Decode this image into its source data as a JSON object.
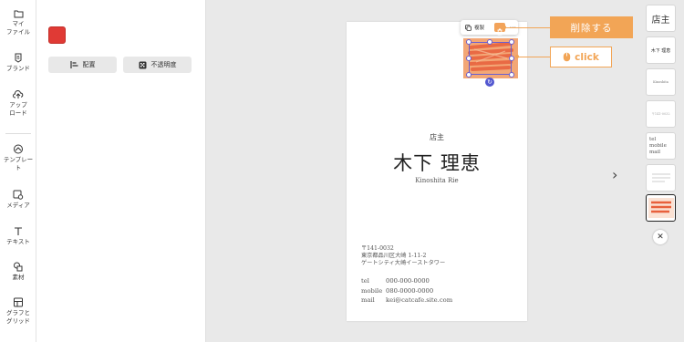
{
  "sidebar": {
    "items": [
      {
        "icon": "folder-icon",
        "label": "マイ\nファイル"
      },
      {
        "icon": "brand-icon",
        "label": "ブランド"
      },
      {
        "icon": "upload-icon",
        "label": "アップ\nロード"
      },
      {
        "icon": "template-icon",
        "label": "テンプレー\nト"
      },
      {
        "icon": "media-icon",
        "label": "メディア"
      },
      {
        "icon": "text-icon",
        "label": "テキスト"
      },
      {
        "icon": "elements-icon",
        "label": "素材"
      },
      {
        "icon": "chart-icon",
        "label": "グラフと\nグリッド"
      }
    ]
  },
  "panel": {
    "selected_color": "#e03a35",
    "align_label": "配置",
    "opacity_label": "不透明度"
  },
  "card": {
    "role": "店主",
    "name": "木下 理恵",
    "roman": "Kinoshita Rie",
    "address": [
      "〒141-0032",
      "東京都品川区大崎 1-11-2",
      "ゲートシティ大崎イーストタワー"
    ],
    "contact": [
      {
        "label": "tel",
        "value": "000-000-0000"
      },
      {
        "label": "mobile",
        "value": "080-0000-0000"
      },
      {
        "label": "mail",
        "value": "kei@catcafe.site.com"
      }
    ]
  },
  "toolbar": {
    "copy_label": "複製",
    "more_label": "···"
  },
  "callouts": {
    "delete_label": "削除する",
    "click_label": "click",
    "accent": "#f2a556"
  },
  "thumbnails": [
    {
      "text": "店主"
    },
    {
      "text": "木下 理恵"
    },
    {
      "text": "Kinoshita"
    },
    {
      "text": "〒141-0032"
    },
    {
      "text": "tel\nmobile\nmail"
    },
    {
      "text": ""
    },
    {
      "text": ""
    }
  ],
  "nav": {
    "next_symbol": "›",
    "close_symbol": "✕"
  }
}
